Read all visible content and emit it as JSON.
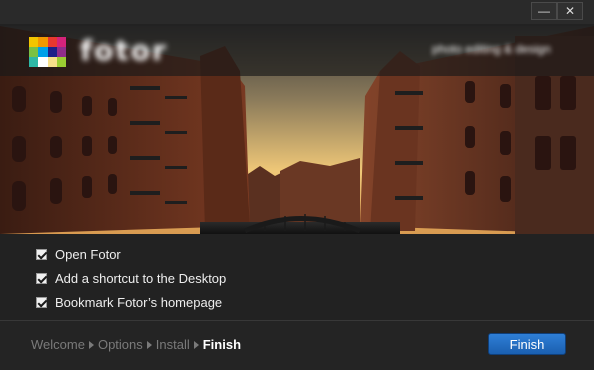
{
  "window": {
    "minimize_symbol": "—",
    "close_symbol": "✕",
    "minimize_icon": "minimize-icon",
    "close_icon": "close-icon"
  },
  "brand": {
    "name": "fotor",
    "tagline": "photo editing & design",
    "logo_colors": [
      "#f2c500",
      "#f39800",
      "#e8382f",
      "#d4237a",
      "#7ac143",
      "#00a0e9",
      "#1d2088",
      "#8f2d8a",
      "#2eb8a6",
      "#ffffff",
      "#f7e08a",
      "#9acd32"
    ]
  },
  "options": [
    {
      "label": "Open Fotor",
      "checked": true
    },
    {
      "label": "Add a shortcut to the Desktop",
      "checked": true
    },
    {
      "label": "Bookmark Fotor’s homepage",
      "checked": true
    }
  ],
  "steps": [
    {
      "label": "Welcome",
      "current": false
    },
    {
      "label": "Options",
      "current": false
    },
    {
      "label": "Install",
      "current": false
    },
    {
      "label": "Finish",
      "current": true
    }
  ],
  "finish_button": {
    "label": "Finish"
  },
  "colors": {
    "accent": "#1f6fc6",
    "background": "#222222",
    "step_inactive": "#7a7a7a",
    "step_active": "#ffffff"
  }
}
